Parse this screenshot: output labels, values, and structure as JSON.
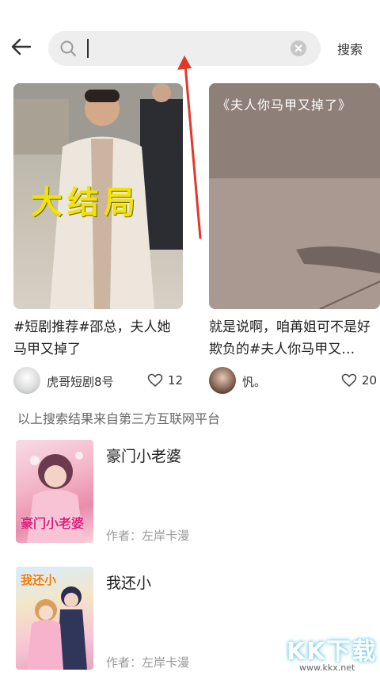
{
  "search": {
    "value": "",
    "button_label": "搜索"
  },
  "cards": [
    {
      "overlay_text": "大结局",
      "description": "#短剧推荐#邵总，夫人她马甲又掉了",
      "author": "虎哥短剧8号",
      "likes": "12"
    },
    {
      "overlay_text": "《夫人你马甲又掉了》",
      "description": "就是说啊，咱苒姐可不是好欺负的#夫人你马甲又…",
      "author": "忛。",
      "likes": "20"
    }
  ],
  "notice": "以上搜索结果来自第三方互联网平台",
  "results": [
    {
      "title": "豪门小老婆",
      "author": "作者：左岸卡漫",
      "cover_text": "豪门小老婆"
    },
    {
      "title": "我还小",
      "author": "作者：左岸卡漫",
      "cover_text": "我还小"
    }
  ],
  "watermark": {
    "text": "KK下载",
    "url": "www.kkx.net"
  },
  "colors": {
    "accent_arrow": "#e0392b",
    "overlay_yellow": "#f2e400",
    "search_bg": "#eeeeee"
  }
}
